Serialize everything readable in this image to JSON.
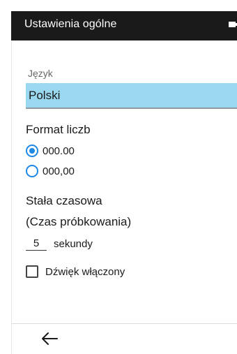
{
  "header": {
    "title": "Ustawienia ogólne",
    "battery_icon": "battery-icon"
  },
  "language": {
    "label": "Język",
    "value": "Polski"
  },
  "number_format": {
    "title": "Format liczb",
    "options": [
      {
        "label": "000.00",
        "selected": true
      },
      {
        "label": "000,00",
        "selected": false
      }
    ]
  },
  "time_constant": {
    "title_line1": "Stała czasowa",
    "title_line2": "(Czas próbkowania)",
    "value": "5",
    "unit": "sekundy"
  },
  "sound": {
    "label": "Dźwięk włączony",
    "checked": false
  },
  "footer": {
    "back_icon": "arrow-left-icon"
  },
  "colors": {
    "accent": "#1e88e5",
    "field_bg": "#99d8ef",
    "header_bg": "#1a1a1a"
  }
}
